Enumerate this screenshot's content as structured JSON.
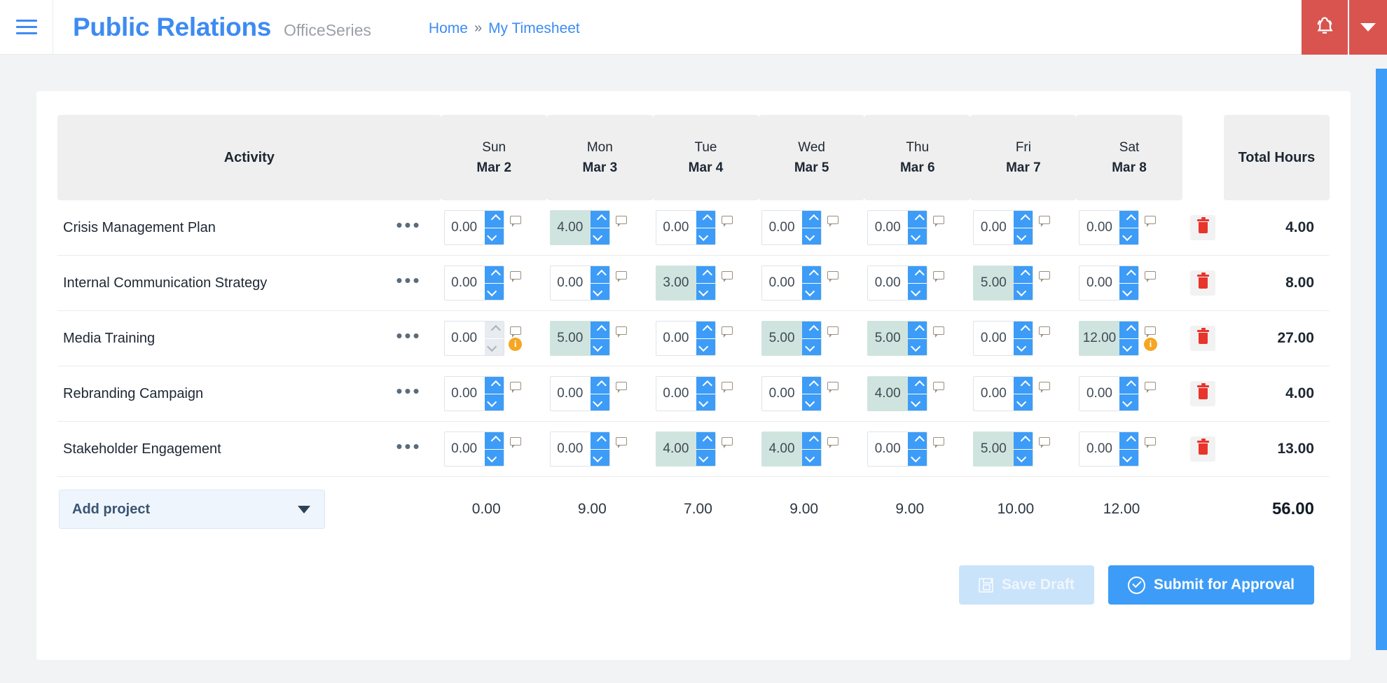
{
  "header": {
    "menu_icon": "hamburger-icon",
    "brand_title": "Public Relations",
    "brand_subtitle": "OfficeSeries",
    "breadcrumb": {
      "home": "Home",
      "separator": "»",
      "current": "My Timesheet"
    },
    "notification_icon": "bell-icon",
    "dropdown_icon": "caret-down-icon",
    "accent_red": "#d9534f",
    "accent_blue": "#3d8bf2"
  },
  "timesheet": {
    "columns": [
      {
        "key": "activity",
        "label": "Activity"
      },
      {
        "key": "sun",
        "day": "Sun",
        "date": "Mar 2"
      },
      {
        "key": "mon",
        "day": "Mon",
        "date": "Mar 3"
      },
      {
        "key": "tue",
        "day": "Tue",
        "date": "Mar 4"
      },
      {
        "key": "wed",
        "day": "Wed",
        "date": "Mar 5"
      },
      {
        "key": "thu",
        "day": "Thu",
        "date": "Mar 6"
      },
      {
        "key": "fri",
        "day": "Fri",
        "date": "Mar 7"
      },
      {
        "key": "sat",
        "day": "Sat",
        "date": "Mar 8"
      },
      {
        "key": "total",
        "label": "Total Hours"
      }
    ],
    "row_menu_glyph": "•••",
    "rows": [
      {
        "activity": "Crisis Management Plan",
        "values": [
          "0.00",
          "4.00",
          "0.00",
          "0.00",
          "0.00",
          "0.00",
          "0.00"
        ],
        "filled": [
          false,
          true,
          false,
          false,
          false,
          false,
          false
        ],
        "disabled": [
          false,
          false,
          false,
          false,
          false,
          false,
          false
        ],
        "info": [
          false,
          false,
          false,
          false,
          false,
          false,
          false
        ],
        "total": "4.00"
      },
      {
        "activity": "Internal Communication Strategy",
        "values": [
          "0.00",
          "0.00",
          "3.00",
          "0.00",
          "0.00",
          "5.00",
          "0.00"
        ],
        "filled": [
          false,
          false,
          true,
          false,
          false,
          true,
          false
        ],
        "disabled": [
          false,
          false,
          false,
          false,
          false,
          false,
          false
        ],
        "info": [
          false,
          false,
          false,
          false,
          false,
          false,
          false
        ],
        "total": "8.00"
      },
      {
        "activity": "Media Training",
        "values": [
          "0.00",
          "5.00",
          "0.00",
          "5.00",
          "5.00",
          "0.00",
          "12.00"
        ],
        "filled": [
          false,
          true,
          false,
          true,
          true,
          false,
          true
        ],
        "disabled": [
          true,
          false,
          false,
          false,
          false,
          false,
          false
        ],
        "info": [
          true,
          false,
          false,
          false,
          false,
          false,
          true
        ],
        "total": "27.00"
      },
      {
        "activity": "Rebranding Campaign",
        "values": [
          "0.00",
          "0.00",
          "0.00",
          "0.00",
          "4.00",
          "0.00",
          "0.00"
        ],
        "filled": [
          false,
          false,
          false,
          false,
          true,
          false,
          false
        ],
        "disabled": [
          false,
          false,
          false,
          false,
          false,
          false,
          false
        ],
        "info": [
          false,
          false,
          false,
          false,
          false,
          false,
          false
        ],
        "total": "4.00"
      },
      {
        "activity": "Stakeholder Engagement",
        "values": [
          "0.00",
          "0.00",
          "4.00",
          "4.00",
          "0.00",
          "5.00",
          "0.00"
        ],
        "filled": [
          false,
          false,
          true,
          true,
          false,
          true,
          false
        ],
        "disabled": [
          false,
          false,
          false,
          false,
          false,
          false,
          false
        ],
        "info": [
          false,
          false,
          false,
          false,
          false,
          false,
          false
        ],
        "total": "13.00"
      }
    ],
    "add_project_label": "Add project",
    "day_totals": [
      "0.00",
      "9.00",
      "7.00",
      "9.00",
      "9.00",
      "10.00",
      "12.00"
    ],
    "grand_total": "56.00",
    "icons": {
      "spinner_up": "chevron-up-icon",
      "spinner_down": "chevron-down-icon",
      "note": "comment-icon",
      "info": "info-icon",
      "delete": "trash-icon",
      "dropdown": "caret-down-icon"
    },
    "colors": {
      "filled_cell": "#cfe4de",
      "spinner_blue": "#3d9cf7",
      "info_orange": "#f5a623",
      "delete_red": "#e8342a"
    }
  },
  "actions": {
    "save_draft": "Save Draft",
    "submit_for_approval": "Submit for Approval",
    "save_icon": "floppy-disk-icon",
    "submit_icon": "check-circle-icon"
  }
}
